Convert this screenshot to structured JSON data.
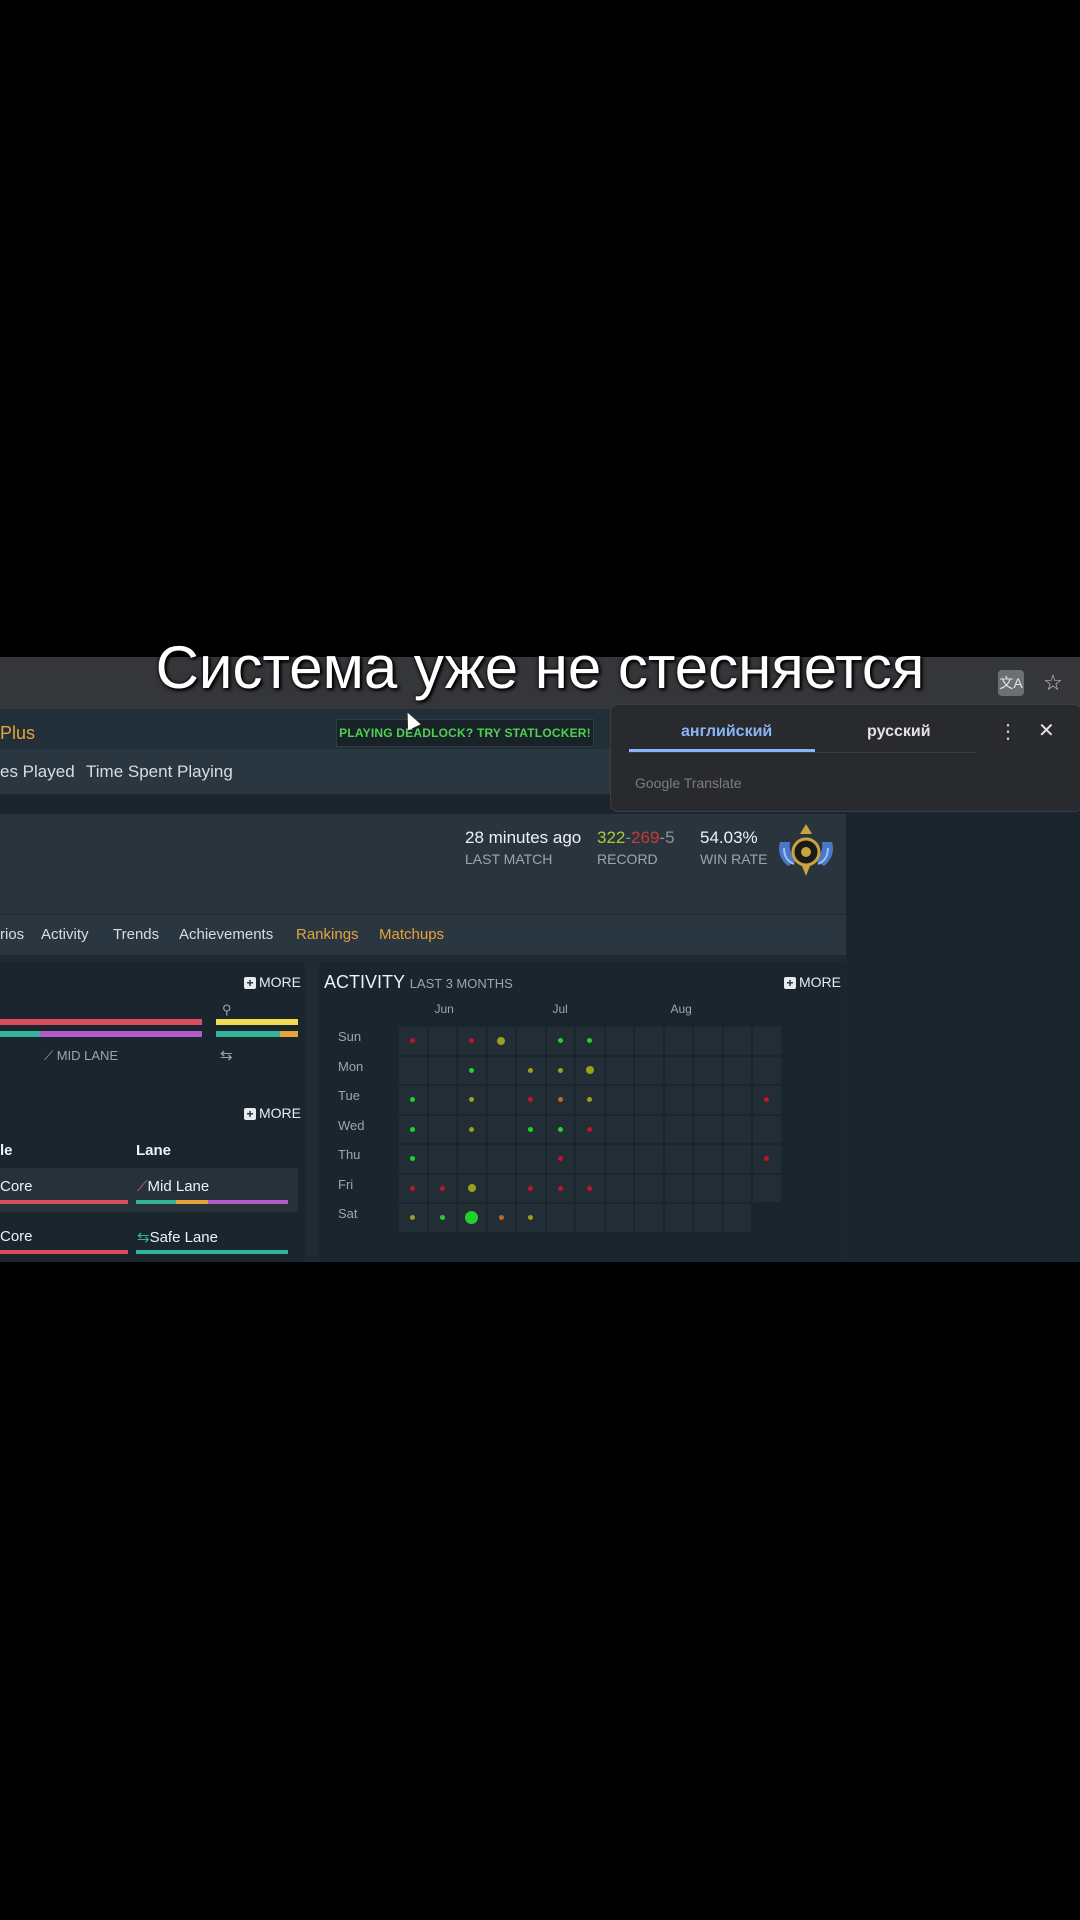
{
  "caption": "Система уже не стесняется",
  "site": {
    "brand": "Plus",
    "promo": "PLAYING DEADLOCK? TRY STATLOCKER!"
  },
  "subnav": [
    "es Played",
    "Time Spent Playing"
  ],
  "header": {
    "last_match_value": "28 minutes ago",
    "last_match_label": "LAST MATCH",
    "record": {
      "wins": "322",
      "losses": "269",
      "abandons": "5",
      "sep": "-"
    },
    "record_label": "RECORD",
    "win_rate_value": "54.03%",
    "win_rate_label": "WIN RATE"
  },
  "tabs": [
    {
      "label": "rios",
      "highlight": false
    },
    {
      "label": "Activity",
      "highlight": false
    },
    {
      "label": "Trends",
      "highlight": false
    },
    {
      "label": "Achievements",
      "highlight": false
    },
    {
      "label": "Rankings",
      "highlight": true
    },
    {
      "label": "Matchups",
      "highlight": true
    }
  ],
  "left_panel": {
    "more_label": "MORE",
    "mid_lane_label": "MID LANE",
    "more_label_2": "MORE",
    "col_role": "le",
    "col_lane": "Lane",
    "rows": [
      {
        "role": "Core",
        "lane": "Mid Lane"
      },
      {
        "role": "Core",
        "lane": "Safe Lane"
      }
    ]
  },
  "activity": {
    "title": "ACTIVITY",
    "subtitle": "LAST 3 MONTHS",
    "more_label": "MORE",
    "months": [
      "Jun",
      "Jul",
      "Aug"
    ],
    "days": [
      "Sun",
      "Mon",
      "Tue",
      "Wed",
      "Thu",
      "Fri",
      "Sat"
    ],
    "colors": {
      "win": "#22d12a",
      "loss": "#c0142a",
      "mixed": "#9aa01e",
      "orange": "#c46a16"
    },
    "matches": [
      {
        "day": "Sun",
        "week": 0,
        "result": "loss",
        "size": 1
      },
      {
        "day": "Sun",
        "week": 2,
        "result": "loss",
        "size": 1
      },
      {
        "day": "Sun",
        "week": 3,
        "result": "mixed",
        "size": 2
      },
      {
        "day": "Sun",
        "week": 5,
        "result": "win",
        "size": 1
      },
      {
        "day": "Sun",
        "week": 6,
        "result": "win",
        "size": 1
      },
      {
        "day": "Mon",
        "week": 2,
        "result": "win",
        "size": 1
      },
      {
        "day": "Mon",
        "week": 4,
        "result": "mixed",
        "size": 1
      },
      {
        "day": "Mon",
        "week": 5,
        "result": "mixed",
        "size": 1
      },
      {
        "day": "Mon",
        "week": 6,
        "result": "mixed",
        "size": 2
      },
      {
        "day": "Tue",
        "week": 0,
        "result": "win",
        "size": 1
      },
      {
        "day": "Tue",
        "week": 2,
        "result": "mixed",
        "size": 1
      },
      {
        "day": "Tue",
        "week": 4,
        "result": "loss",
        "size": 1
      },
      {
        "day": "Tue",
        "week": 5,
        "result": "orange",
        "size": 1
      },
      {
        "day": "Tue",
        "week": 6,
        "result": "mixed",
        "size": 1
      },
      {
        "day": "Tue",
        "week": 12,
        "result": "loss",
        "size": 1
      },
      {
        "day": "Wed",
        "week": 0,
        "result": "win",
        "size": 1
      },
      {
        "day": "Wed",
        "week": 2,
        "result": "mixed",
        "size": 1
      },
      {
        "day": "Wed",
        "week": 4,
        "result": "win",
        "size": 1
      },
      {
        "day": "Wed",
        "week": 5,
        "result": "win",
        "size": 1
      },
      {
        "day": "Wed",
        "week": 6,
        "result": "loss",
        "size": 1
      },
      {
        "day": "Thu",
        "week": 0,
        "result": "win",
        "size": 1
      },
      {
        "day": "Thu",
        "week": 5,
        "result": "loss",
        "size": 1
      },
      {
        "day": "Thu",
        "week": 12,
        "result": "loss",
        "size": 1
      },
      {
        "day": "Fri",
        "week": 0,
        "result": "loss",
        "size": 1
      },
      {
        "day": "Fri",
        "week": 1,
        "result": "loss",
        "size": 1
      },
      {
        "day": "Fri",
        "week": 2,
        "result": "mixed",
        "size": 2
      },
      {
        "day": "Fri",
        "week": 4,
        "result": "loss",
        "size": 1
      },
      {
        "day": "Fri",
        "week": 5,
        "result": "loss",
        "size": 1
      },
      {
        "day": "Fri",
        "week": 6,
        "result": "loss",
        "size": 1
      },
      {
        "day": "Sat",
        "week": 0,
        "result": "mixed",
        "size": 1
      },
      {
        "day": "Sat",
        "week": 1,
        "result": "win",
        "size": 1
      },
      {
        "day": "Sat",
        "week": 2,
        "result": "win",
        "size": 3
      },
      {
        "day": "Sat",
        "week": 3,
        "result": "orange",
        "size": 1
      },
      {
        "day": "Sat",
        "week": 4,
        "result": "mixed",
        "size": 1
      }
    ]
  },
  "translate_popup": {
    "lang_from": "английский",
    "lang_to": "русский",
    "powered_by": "Google Translate"
  }
}
